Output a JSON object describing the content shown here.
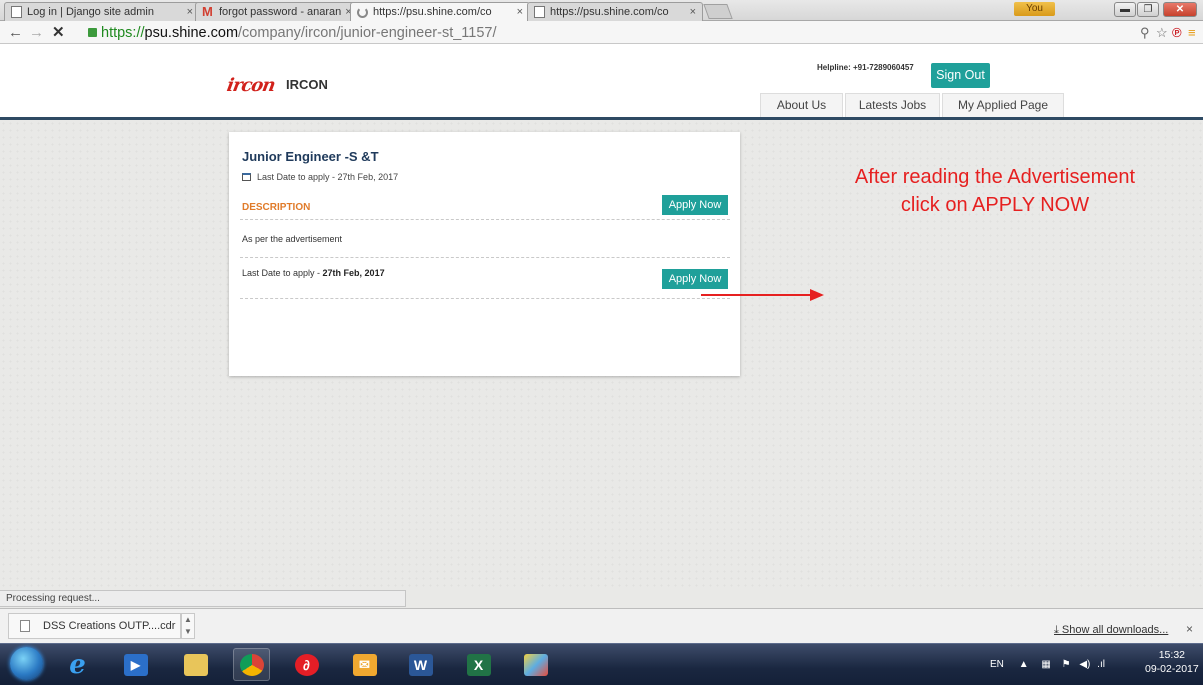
{
  "browser": {
    "tabs": [
      {
        "title": "Log in | Django site admin",
        "icon": "page-icon"
      },
      {
        "title": "forgot password - anaran",
        "icon": "gmail-icon"
      },
      {
        "title": "https://psu.shine.com/co",
        "icon": "loading-icon"
      },
      {
        "title": "https://psu.shine.com/co",
        "icon": "page-icon"
      }
    ],
    "tab_close": "×",
    "user_badge": "You",
    "url": {
      "protocol": "https://",
      "host": "psu.shine.com",
      "path": "/company/ircon/junior-engineer-st_1157/"
    },
    "status_text": "Processing request..."
  },
  "site": {
    "logo_text": "ircon",
    "company_name": "IRCON",
    "helpline": "Helpline: +91-7289060457",
    "sign_out": "Sign Out",
    "nav": [
      "About Us",
      "Latests Jobs",
      "My Applied Page"
    ]
  },
  "job": {
    "title": "Junior Engineer -S &T",
    "last_date_top": "Last Date to apply - 27th Feb, 2017",
    "description_heading": "DESCRIPTION",
    "apply_label": "Apply Now",
    "description_text": "As per the advertisement",
    "last_date_label": "Last Date to apply - ",
    "last_date_value": "27th Feb, 2017"
  },
  "annotation": {
    "line1": "After reading the Advertisement",
    "line2": "click on APPLY NOW",
    "color": "#e62020"
  },
  "downloads": {
    "file_name": "DSS Creations OUTP....cdr",
    "show_all": "Show all downloads...",
    "close": "×"
  },
  "taskbar": {
    "language": "EN",
    "time": "15:32",
    "date": "09-02-2017"
  },
  "colors": {
    "accent": "#1fa09a",
    "header_rule": "#2e4a63",
    "description": "#e07b2a",
    "title": "#1f3a5b"
  }
}
